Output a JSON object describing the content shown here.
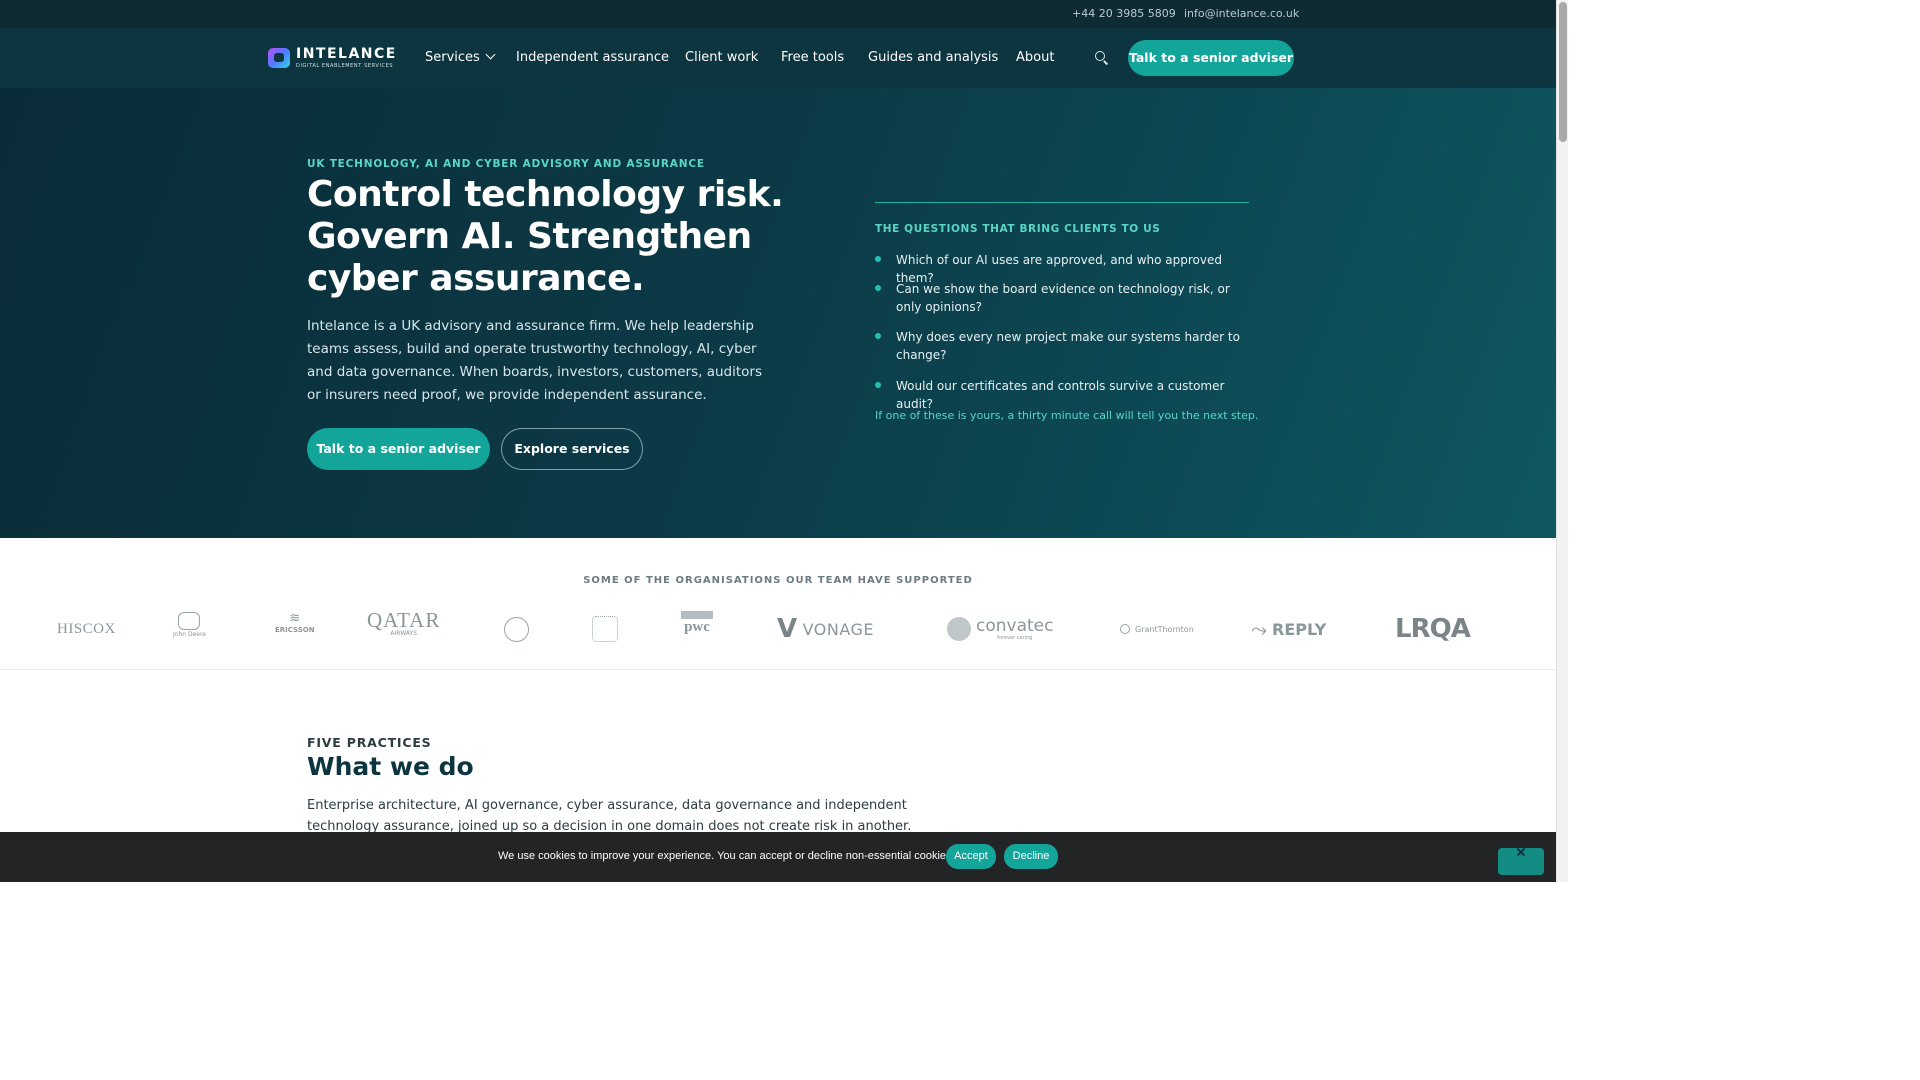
{
  "topbar": {
    "phone": "+44 20 3985 5809",
    "email": "info@intelance.co.uk"
  },
  "brand": {
    "name": "INTELANCE",
    "tagline": "DIGITAL ENABLEMENT SERVICES"
  },
  "nav": {
    "items": [
      "Services",
      "Independent assurance",
      "Client work",
      "Free tools",
      "Guides and analysis",
      "About"
    ],
    "cta": "Talk to a senior adviser"
  },
  "hero": {
    "eyebrow": "UK TECHNOLOGY, AI AND CYBER ADVISORY AND ASSURANCE",
    "title": "Control technology risk. Govern AI. Strengthen cyber assurance.",
    "body": "Intelance is a UK advisory and assurance firm. We help leadership teams assess, build and operate trustworthy technology, AI, cyber and data governance. When boards, investors, customers, auditors or insurers need proof, we provide independent assurance.",
    "primary_button": "Talk to a senior adviser",
    "secondary_button": "Explore services"
  },
  "questions": {
    "heading": "THE QUESTIONS THAT BRING CLIENTS TO US",
    "items": [
      "Which of our AI uses are approved, and who approved them?",
      "Can we show the board evidence on technology risk, or only opinions?",
      "Why does every new project make our systems harder to change?",
      "Would our certificates and controls survive a customer audit?"
    ],
    "note": "If one of these is yours, a thirty minute call will tell you the next step."
  },
  "clients": {
    "heading": "SOME OF THE ORGANISATIONS OUR TEAM HAVE SUPPORTED",
    "logos": [
      "HISCOX",
      "John Deere",
      "ERICSSON",
      "QATAR",
      "AIRWAYS",
      "pwc",
      "VONAGE",
      "convatec",
      "forever caring",
      "GrantThornton",
      "REPLY",
      "LRQA"
    ]
  },
  "practices": {
    "eyebrow": "FIVE PRACTICES",
    "title": "What we do",
    "body": "Enterprise architecture, AI governance, cyber assurance, data governance and independent technology assurance, joined up so a decision in one domain does not create risk in another. Every engagement has"
  },
  "cookie": {
    "text": "We use cookies to improve your experience. You can accept or decline non-essential cookies.",
    "accept": "Accept",
    "decline": "Decline"
  },
  "colors": {
    "accent": "#14a59a",
    "navy": "#0d3540",
    "mint": "#5ad6c5"
  }
}
